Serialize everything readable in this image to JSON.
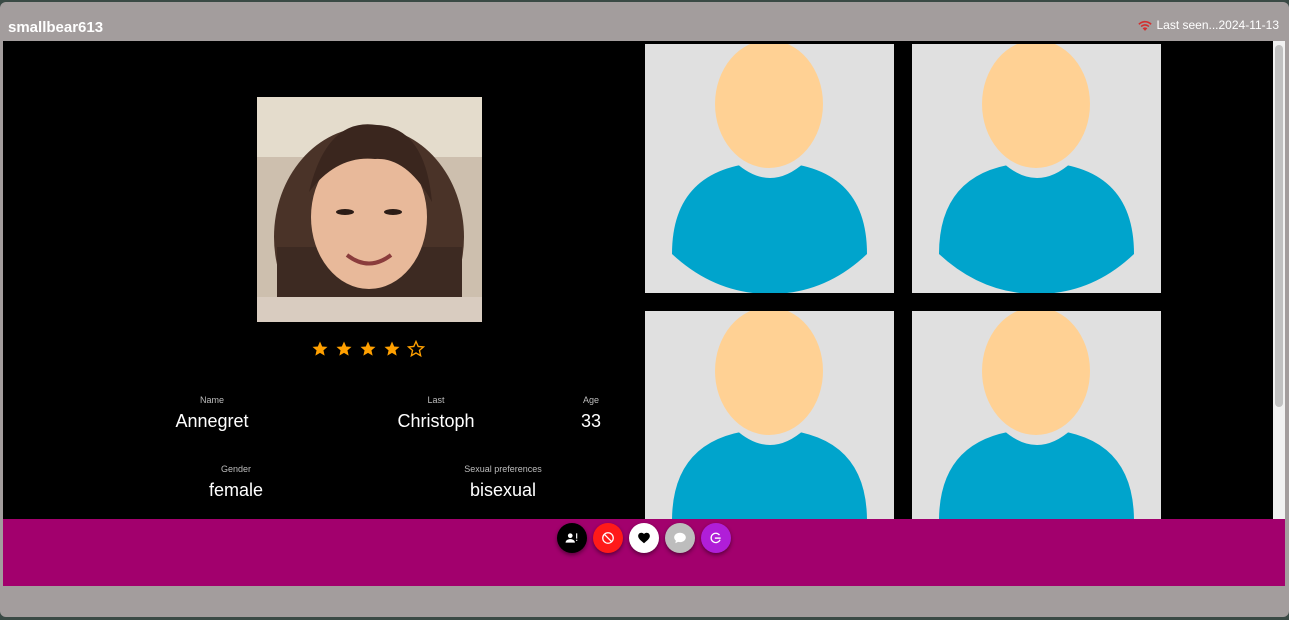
{
  "header": {
    "username": "smallbear613",
    "last_seen": "Last seen...2024-11-13",
    "status_color": "#d32f2f"
  },
  "profile": {
    "rating": 4,
    "rating_max": 5,
    "star_color": "#ffa000",
    "fields": {
      "name": {
        "label": "Name",
        "value": "Annegret"
      },
      "last": {
        "label": "Last",
        "value": "Christoph"
      },
      "age": {
        "label": "Age",
        "value": "33"
      },
      "gender": {
        "label": "Gender",
        "value": "female"
      },
      "preferences": {
        "label": "Sexual preferences",
        "value": "bisexual"
      }
    }
  },
  "gallery": {
    "placeholder_colors": {
      "background": "#e0e0e0",
      "head": "#ffd194",
      "body": "#00a4cc"
    }
  },
  "actions": [
    {
      "name": "add-friend",
      "icon": "person-add-icon",
      "color": "#000000"
    },
    {
      "name": "block",
      "icon": "block-icon",
      "color": "#ff1a1a"
    },
    {
      "name": "like",
      "icon": "heart-icon",
      "color": "#ffffff"
    },
    {
      "name": "chat",
      "icon": "chat-icon",
      "color": "#bdbdbd"
    },
    {
      "name": "report",
      "icon": "report-icon",
      "color": "#b01ed8"
    }
  ],
  "theme": {
    "footer": "#a2006d",
    "frame": "#a39d9d"
  }
}
